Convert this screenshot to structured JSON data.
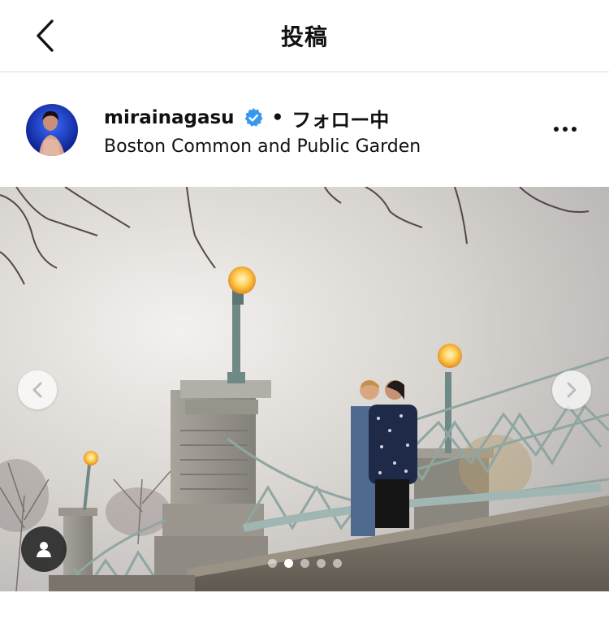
{
  "header": {
    "title": "投稿",
    "back_icon": "chevron-left-icon"
  },
  "post": {
    "username": "mirainagasu",
    "verified": true,
    "separator": "•",
    "follow_status": "フォロー中",
    "location": "Boston Common and Public Garden",
    "more_icon": "more-horizontal-icon"
  },
  "carousel": {
    "slide_count": 5,
    "active_index": 1,
    "prev_icon": "chevron-left-icon",
    "next_icon": "chevron-right-icon",
    "tag_icon": "user-tag-icon"
  },
  "colors": {
    "verified": "#3897f0",
    "divider": "#dbdbdb"
  }
}
